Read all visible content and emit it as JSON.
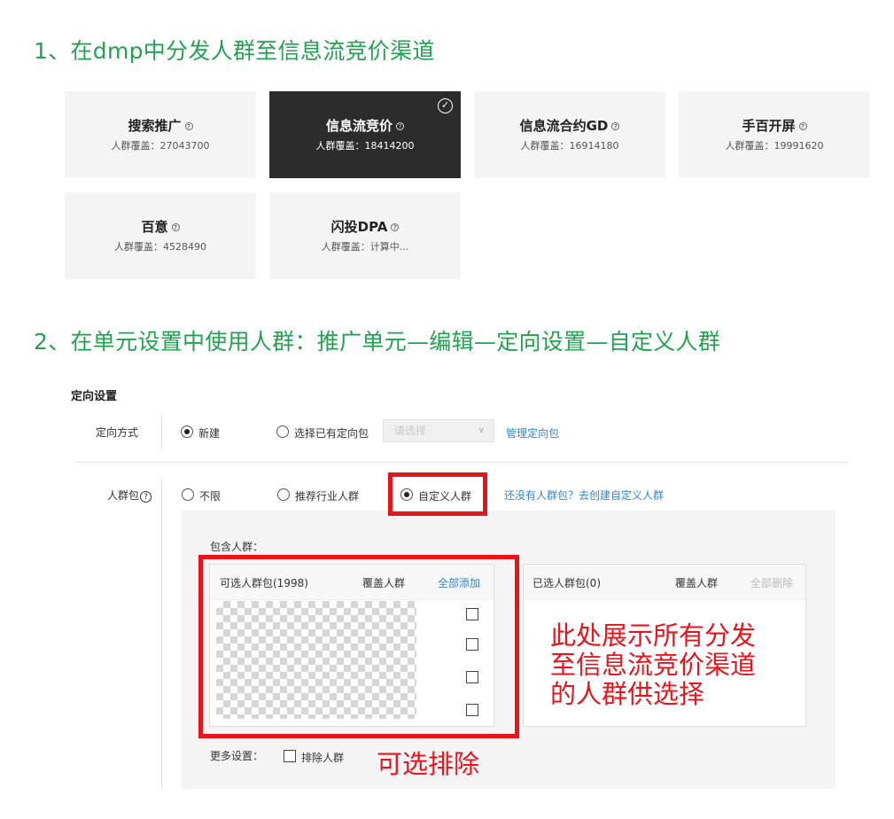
{
  "step1": {
    "title": "1、在dmp中分发人群至信息流竞价渠道"
  },
  "channels": [
    {
      "name": "搜索推广",
      "coverage": "人群覆盖：27043700",
      "selected": false
    },
    {
      "name": "信息流竞价",
      "coverage": "人群覆盖：18414200",
      "selected": true
    },
    {
      "name": "信息流合约GD",
      "coverage": "人群覆盖：16914180",
      "selected": false
    },
    {
      "name": "手百开屏",
      "coverage": "人群覆盖：19991620",
      "selected": false
    },
    {
      "name": "百意",
      "coverage": "人群覆盖：4528490",
      "selected": false
    },
    {
      "name": "闪投DPA",
      "coverage": "人群覆盖：计算中...",
      "selected": false
    }
  ],
  "icons": {
    "help": "?",
    "check": "✓",
    "caret": "∨"
  },
  "step2": {
    "title": "2、在单元设置中使用人群：推广单元—编辑—定向设置—自定义人群"
  },
  "targeting": {
    "section_title": "定向设置",
    "method_label": "定向方式",
    "method_new": "新建",
    "method_existing": "选择已有定向包",
    "select_placeholder": "请选择",
    "manage_link": "管理定向包",
    "audience_label": "人群包",
    "audience_help": "?",
    "opt_unlimited": "不限",
    "opt_industry": "推荐行业人群",
    "opt_custom": "自定义人群",
    "create_link": "还没有人群包？去创建自定义人群",
    "include_label": "包含人群：",
    "available_header": "可选人群包(1998)",
    "coverage_header": "覆盖人群",
    "add_all": "全部添加",
    "selected_header": "已选人群包(0)",
    "selected_coverage_header": "覆盖人群",
    "delete_all": "全部删除",
    "more_settings": "更多设置：",
    "exclude_label": "排除人群"
  },
  "annotations": {
    "note_line1": "此处展示所有分发",
    "note_line2": "至信息流竞价渠道",
    "note_line3": "的人群供选择",
    "exclude_note": "可选排除",
    "color": "#e8141c"
  },
  "colors": {
    "accent_green": "#21a24f",
    "link_blue": "#2f86d6",
    "selected_card": "#2c2c2c"
  }
}
